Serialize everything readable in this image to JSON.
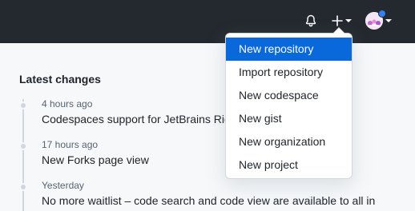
{
  "header": {
    "notifications_icon": "bell-icon",
    "create_icon": "plus-icon",
    "create_caret_icon": "caret-down-icon",
    "avatar_caret_icon": "caret-down-icon",
    "background_color": "#24292f"
  },
  "latest_changes": {
    "title": "Latest changes",
    "items": [
      {
        "time": "4 hours ago",
        "title": "Codespaces support for JetBrains Rider"
      },
      {
        "time": "17 hours ago",
        "title": "New Forks page view"
      },
      {
        "time": "Yesterday",
        "title": "No more waitlist – code search and code view are available to all in"
      }
    ]
  },
  "create_menu": {
    "active_index": 0,
    "active_color": "#0969da",
    "items": [
      {
        "label": "New repository"
      },
      {
        "label": "Import repository"
      },
      {
        "label": "New codespace"
      },
      {
        "label": "New gist"
      },
      {
        "label": "New organization"
      },
      {
        "label": "New project"
      }
    ]
  }
}
